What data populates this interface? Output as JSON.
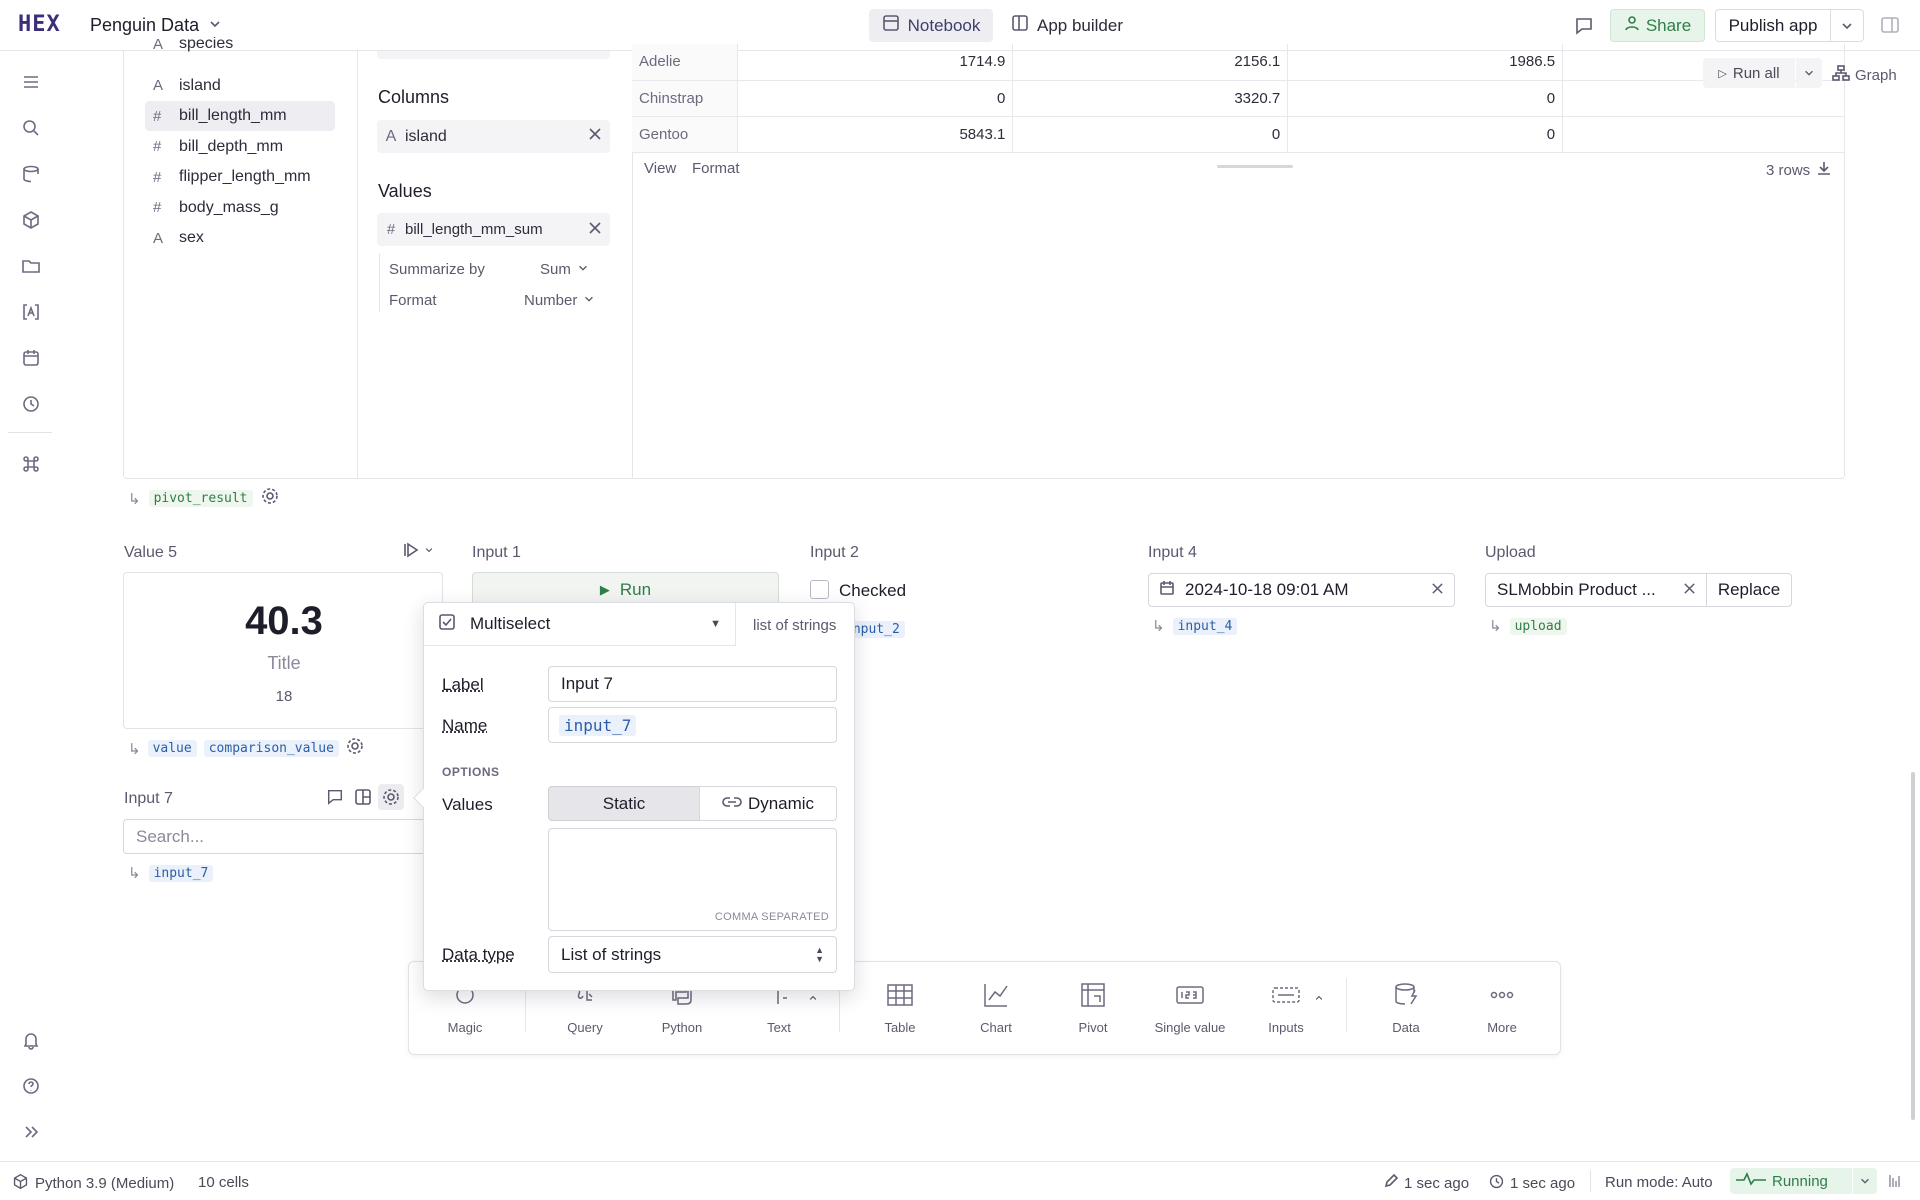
{
  "app": {
    "logo": "HEX",
    "project_title": "Penguin Data"
  },
  "topbar": {
    "notebook_label": "Notebook",
    "app_builder_label": "App builder",
    "share_label": "Share",
    "publish_label": "Publish app"
  },
  "sidebar_icons": [
    "outline-icon",
    "search-icon",
    "data-browser-icon",
    "components-icon",
    "files-icon",
    "variables-icon",
    "schedule-icon",
    "history-icon",
    "command-icon",
    "bell-icon",
    "help-icon",
    "expand-icon"
  ],
  "pivot": {
    "columns_list": [
      "species",
      "island",
      "bill_length_mm",
      "bill_depth_mm",
      "flipper_length_mm",
      "body_mass_g",
      "sex"
    ],
    "columns_types": [
      "A",
      "A",
      "#",
      "#",
      "#",
      "#",
      "A"
    ],
    "columns_heading": "Columns",
    "columns_value": "island",
    "values_heading": "Values",
    "values_value": "bill_length_mm_sum",
    "summarize_label": "Summarize by",
    "summarize_value": "Sum",
    "format_label": "Format",
    "format_value": "Number",
    "run_all_label": "Run all",
    "graph_label": "Graph",
    "table_rows": [
      {
        "label": "Adelie",
        "v1": "1714.9",
        "v2": "2156.1",
        "v3": "1986.5"
      },
      {
        "label": "Chinstrap",
        "v1": "0",
        "v2": "3320.7",
        "v3": "0"
      },
      {
        "label": "Gentoo",
        "v1": "5843.1",
        "v2": "0",
        "v3": "0"
      }
    ],
    "view_label": "View",
    "format_tab_label": "Format",
    "rows_count": "3 rows",
    "output_var": "pivot_result"
  },
  "value5": {
    "label": "Value 5",
    "number": "40.3",
    "title": "Title",
    "comparison": "18",
    "var1": "value",
    "var2": "comparison_value"
  },
  "input1": {
    "label": "Input 1",
    "button": "Run"
  },
  "input2": {
    "label": "Input 2",
    "checkbox_label": "Checked",
    "var": "input_2"
  },
  "input4": {
    "label": "Input 4",
    "value": "2024-10-18 09:01 AM",
    "var": "input_4"
  },
  "upload": {
    "label": "Upload",
    "file": "SLMobbin Product ...",
    "replace": "Replace",
    "var": "upload"
  },
  "input7": {
    "label": "Input 7",
    "placeholder": "Search...",
    "var": "input_7"
  },
  "popover": {
    "type": "Multiselect",
    "type_hint": "list of strings",
    "label_label": "Label",
    "label_value": "Input 7",
    "name_label": "Name",
    "name_value": "input_7",
    "options_heading": "OPTIONS",
    "values_label": "Values",
    "static_label": "Static",
    "dynamic_label": "Dynamic",
    "comma_hint": "COMMA SEPARATED",
    "datatype_label": "Data type",
    "datatype_value": "List of strings"
  },
  "toolbar": {
    "magic": "Magic",
    "query": "Query",
    "python": "Python",
    "text": "Text",
    "table": "Table",
    "chart": "Chart",
    "pivot": "Pivot",
    "single_value": "Single value",
    "inputs": "Inputs",
    "data": "Data",
    "more": "More"
  },
  "status": {
    "kernel": "Python 3.9 (Medium)",
    "cells": "10 cells",
    "edited": "1 sec ago",
    "ran": "1 sec ago",
    "run_mode": "Run mode: Auto",
    "running": "Running"
  }
}
